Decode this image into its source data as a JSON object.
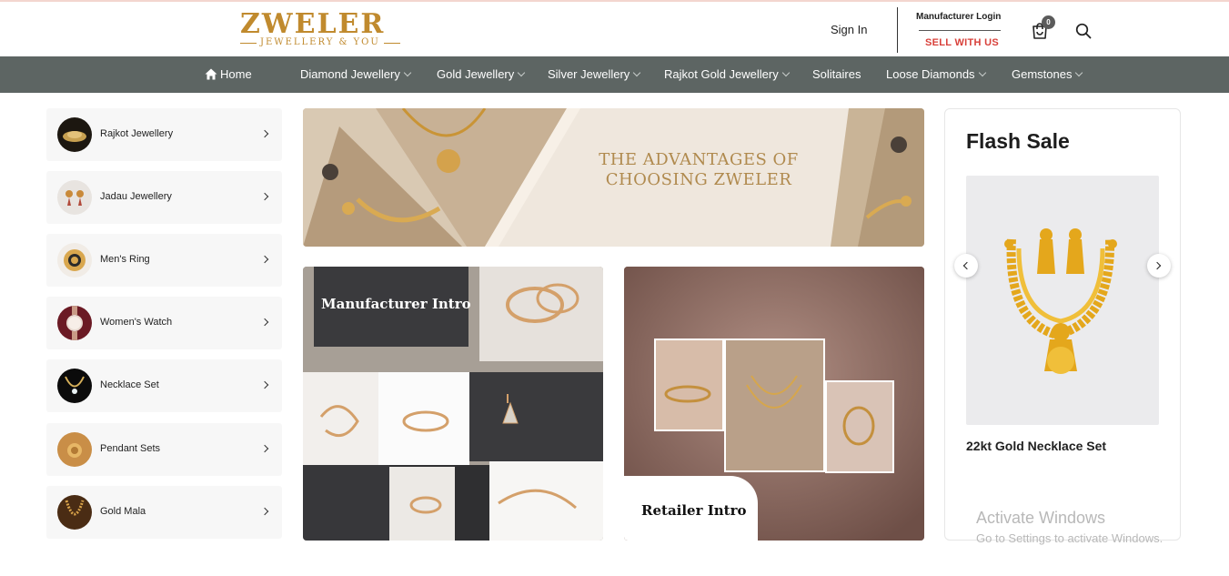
{
  "brand": {
    "name": "ZWELER",
    "tagline": "JEWELLERY & YOU",
    "accent": "#c08a2e"
  },
  "header": {
    "sign_in": "Sign In",
    "manufacturer_login": "Manufacturer Login",
    "sell_with_us": "SELL WITH US",
    "cart_count": "0",
    "cart_icon": "cart-icon",
    "search_icon": "search-icon"
  },
  "nav": {
    "bg": "#5d6563",
    "items": [
      {
        "label": "Home",
        "dropdown": false
      },
      {
        "label": "Diamond Jewellery",
        "dropdown": true
      },
      {
        "label": "Gold Jewellery",
        "dropdown": true
      },
      {
        "label": "Silver Jewellery",
        "dropdown": true
      },
      {
        "label": "Rajkot Gold Jewellery",
        "dropdown": true
      },
      {
        "label": "Solitaires",
        "dropdown": false
      },
      {
        "label": "Loose Diamonds",
        "dropdown": true
      },
      {
        "label": "Gemstones",
        "dropdown": true
      }
    ]
  },
  "categories": [
    {
      "label": "Rajkot Jewellery",
      "icon": "rajkot-jewellery-thumb"
    },
    {
      "label": "Jadau Jewellery",
      "icon": "jadau-jewellery-thumb"
    },
    {
      "label": "Men's Ring",
      "icon": "mens-ring-thumb"
    },
    {
      "label": "Women's Watch",
      "icon": "womens-watch-thumb"
    },
    {
      "label": "Necklace Set",
      "icon": "necklace-set-thumb"
    },
    {
      "label": "Pendant Sets",
      "icon": "pendant-sets-thumb"
    },
    {
      "label": "Gold Mala",
      "icon": "gold-mala-thumb"
    }
  ],
  "banner": {
    "title": "THE ADVANTAGES OF CHOOSING ZWELER"
  },
  "promos": {
    "manufacturer": "Manufacturer Intro",
    "retailer": "Retailer Intro"
  },
  "flash_sale": {
    "title": "Flash Sale",
    "product": "22kt Gold Necklace Set"
  },
  "watermark": {
    "line1": "Activate Windows",
    "line2": "Go to Settings to activate Windows."
  }
}
